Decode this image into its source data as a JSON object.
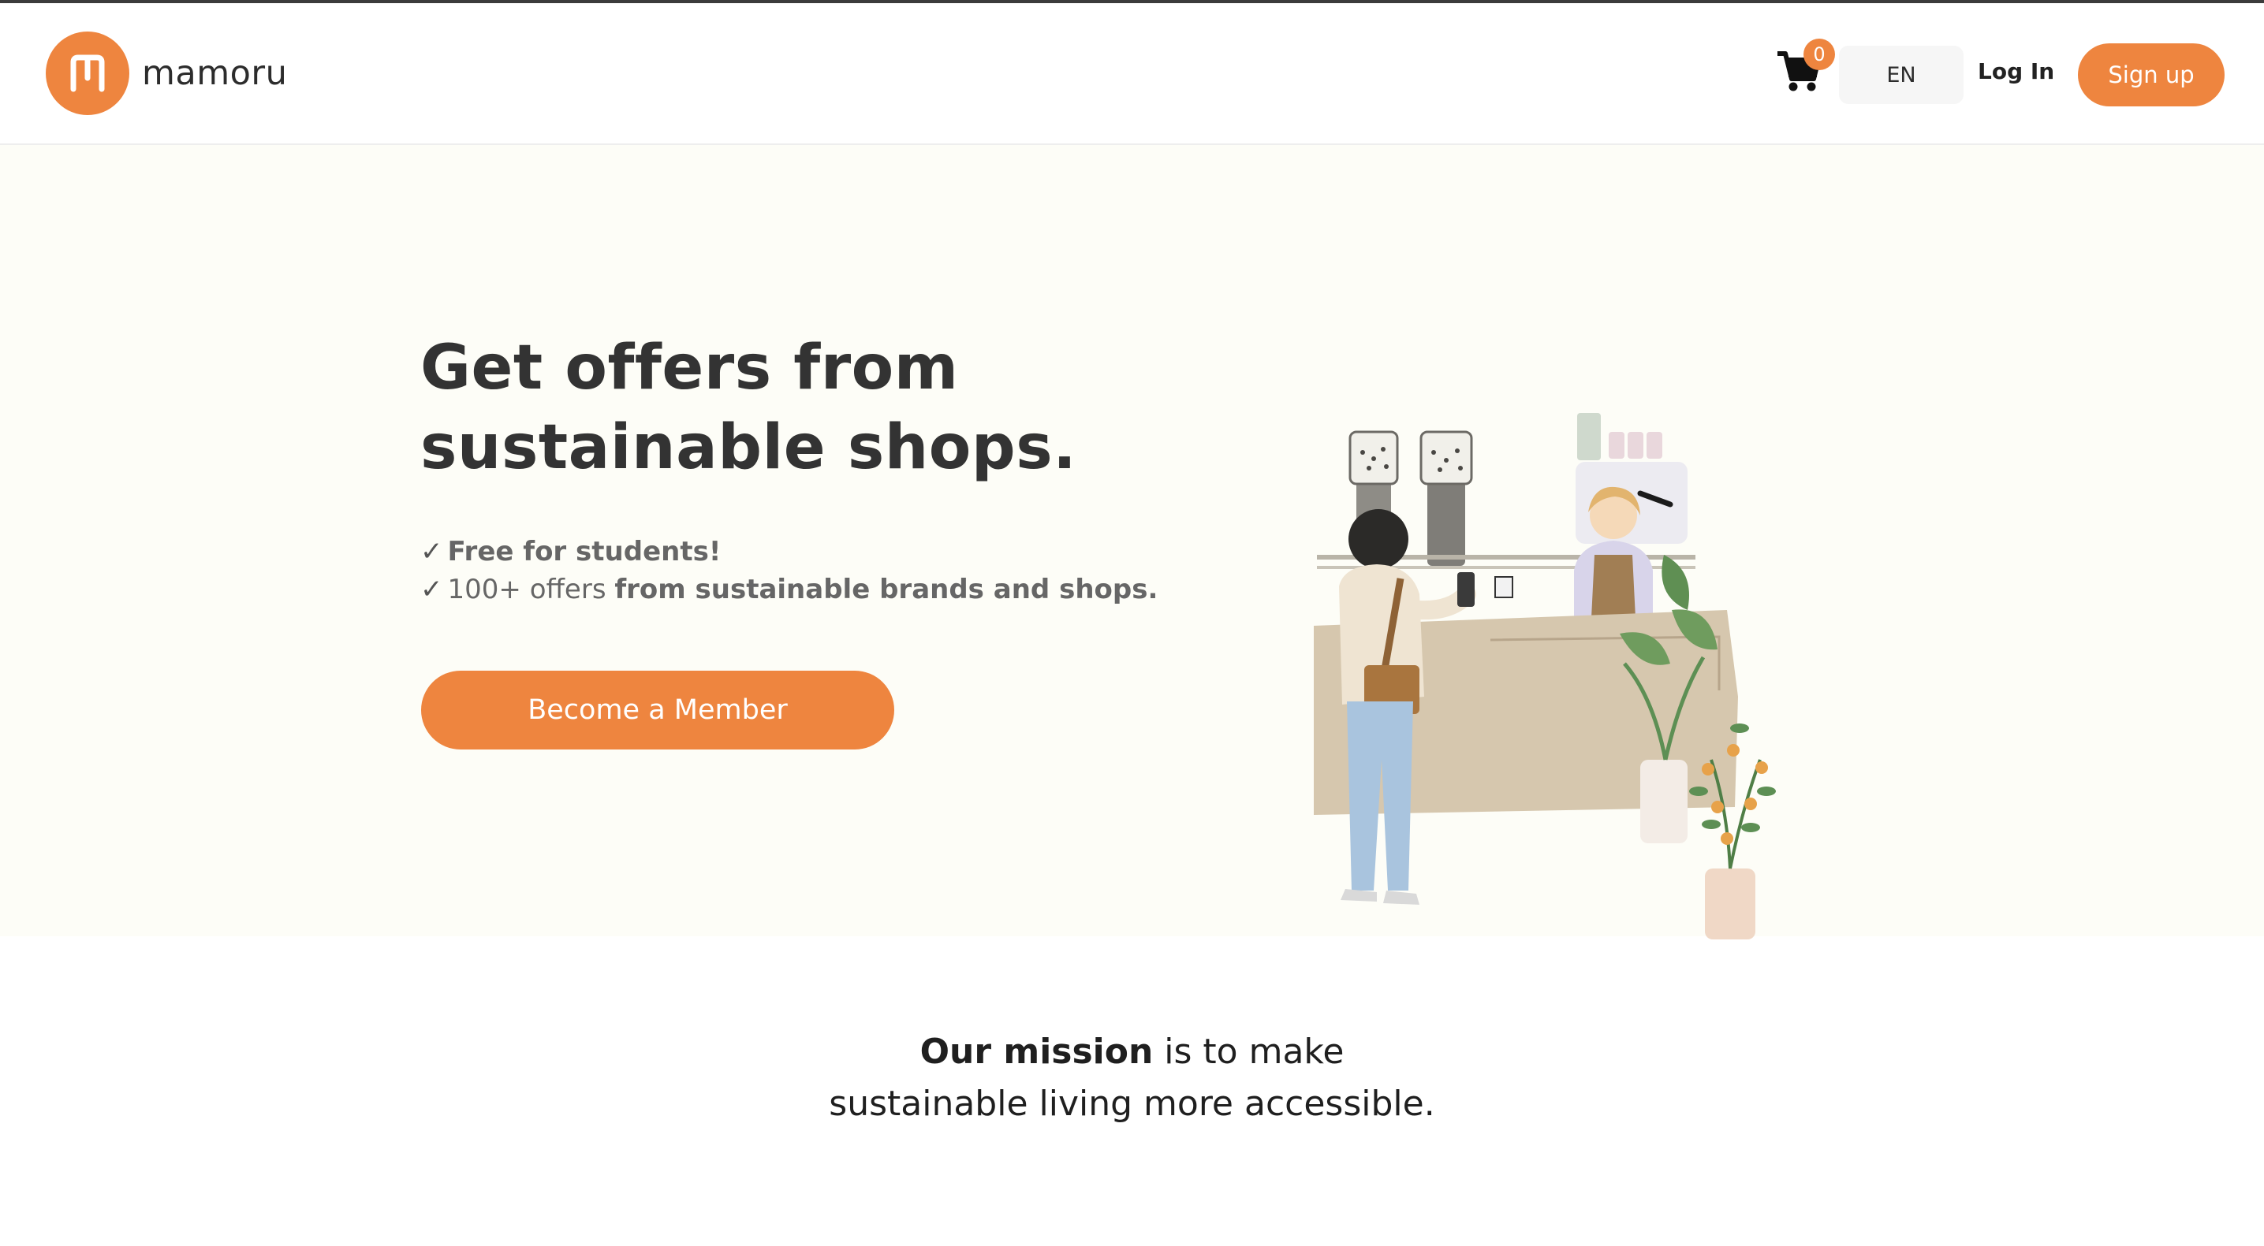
{
  "brand": {
    "name": "mamoru",
    "logo_letter": "M",
    "accent_color": "#ee853f"
  },
  "header": {
    "cart_count": "0",
    "cart_icon": "shopping-cart-icon",
    "language": "EN",
    "login_label": "Log In",
    "signup_label": "Sign up"
  },
  "hero": {
    "title_line1": "Get offers from",
    "title_line2": "sustainable shops.",
    "bullets": [
      {
        "check": "✓",
        "bold": "Free for students!",
        "text": ""
      },
      {
        "check": "✓",
        "text": "100+ offers",
        "bold": "from sustainable brands and shops."
      }
    ],
    "cta_label": "Become a Member"
  },
  "mission": {
    "bold": "Our mission",
    "text_line1": " is to make",
    "text_line2": "sustainable living more accessible."
  }
}
